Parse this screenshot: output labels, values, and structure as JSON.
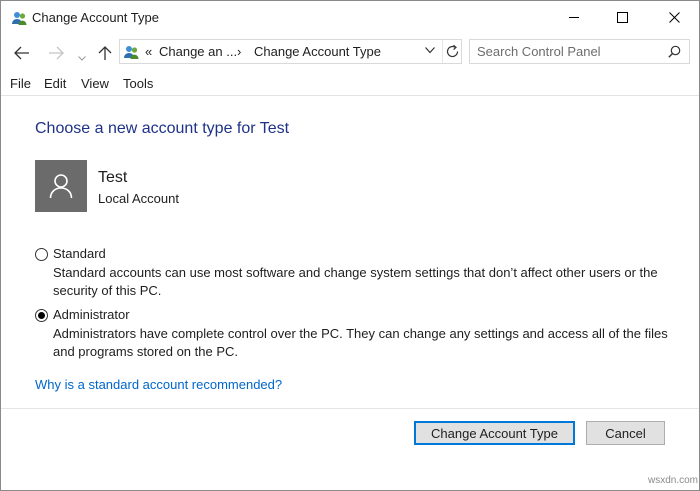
{
  "window": {
    "title": "Change Account Type"
  },
  "navigation": {
    "breadcrumb": {
      "prefix": "«",
      "parent": "Change an ...",
      "separator": "›",
      "current": "Change Account Type"
    },
    "search_placeholder": "Search Control Panel"
  },
  "menu": {
    "items": [
      "File",
      "Edit",
      "View",
      "Tools"
    ]
  },
  "content": {
    "heading": "Choose a new account type for Test",
    "user": {
      "name": "Test",
      "type": "Local Account"
    },
    "options": [
      {
        "label": "Standard",
        "selected": false,
        "description_line1": "Standard accounts can use most software and change system settings that don’t affect other users or the",
        "description_line2": "security of this PC."
      },
      {
        "label": "Administrator",
        "selected": true,
        "description_line1": "Administrators have complete control over the PC. They can change any settings and access all of the files",
        "description_line2": "and programs stored on the PC."
      }
    ],
    "help_link": "Why is a standard account recommended?"
  },
  "footer": {
    "primary_button": "Change Account Type",
    "cancel_button": "Cancel"
  },
  "watermark": "wsxdn.com",
  "colors": {
    "heading": "#1e3287",
    "link": "#0066cc",
    "accent": "#0078d7",
    "avatar_bg": "#6b6b6b"
  }
}
